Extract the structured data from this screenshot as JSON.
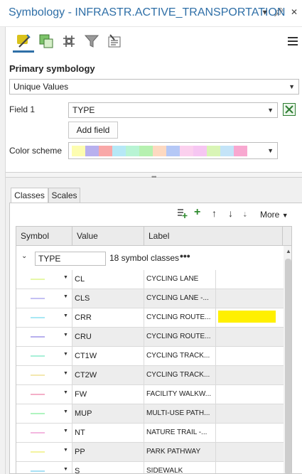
{
  "window": {
    "title": "Symbology - INFRASTR.ACTIVE_TRANSPORTATION",
    "icons": [
      "chevron-down-icon",
      "pin-icon",
      "close-icon"
    ]
  },
  "toolbar": {
    "icons": [
      "primary-symbology-icon",
      "vary-symbology-icon",
      "symbol-layers-icon",
      "filter-icon",
      "properties-icon",
      "menu-icon"
    ]
  },
  "primary": {
    "heading": "Primary symbology",
    "renderer": "Unique Values",
    "field1_label": "Field 1",
    "field1_value": "TYPE",
    "add_field": "Add field",
    "color_scheme_label": "Color scheme",
    "color_scheme_colors": [
      "#fdfdb0",
      "#b8b0ee",
      "#f9a8a8",
      "#b6e8f6",
      "#b8f4d4",
      "#b6f1b0",
      "#fdd9c1",
      "#b5c8f6",
      "#fbd0ee",
      "#f6c6f2",
      "#d9f5b6",
      "#c4e4f8",
      "#f8a8d0"
    ]
  },
  "tabs": [
    {
      "label": "Classes",
      "active": true
    },
    {
      "label": "Scales",
      "active": false
    }
  ],
  "class_tools": {
    "more_label": "More",
    "icons": [
      "add-values-icon",
      "add-icon",
      "move-up-icon",
      "move-down-icon",
      "more-chevron-down-icon"
    ]
  },
  "grid": {
    "columns": [
      "Symbol",
      "Value",
      "Label"
    ],
    "group": {
      "field": "TYPE",
      "count_text": "18 symbol classes",
      "menu": "•••"
    },
    "rows": [
      {
        "value": "CL",
        "label": "CYCLING LANE",
        "color": "#e6f7a8",
        "highlight": false
      },
      {
        "value": "CLS",
        "label": "CYCLING LANE -...",
        "color": "#c4c0f4",
        "highlight": false
      },
      {
        "value": "CRR",
        "label": "CYCLING ROUTE...",
        "color": "#a8e8f4",
        "highlight": true
      },
      {
        "value": "CRU",
        "label": "CYCLING ROUTE...",
        "color": "#b8b0ee",
        "highlight": false
      },
      {
        "value": "CT1W",
        "label": "CYCLING TRACK...",
        "color": "#a8f0d8",
        "highlight": false
      },
      {
        "value": "CT2W",
        "label": "CYCLING TRACK...",
        "color": "#f4e8b0",
        "highlight": false
      },
      {
        "value": "FW",
        "label": "FACILITY WALKW...",
        "color": "#f4b0c8",
        "highlight": false
      },
      {
        "value": "MUP",
        "label": "MULTI-USE PATH...",
        "color": "#b0f4c0",
        "highlight": false
      },
      {
        "value": "NT",
        "label": "NATURE TRAIL -...",
        "color": "#f4b8e0",
        "highlight": false
      },
      {
        "value": "PP",
        "label": "PARK PATHWAY",
        "color": "#f4f4a0",
        "highlight": false
      },
      {
        "value": "S",
        "label": "SIDEWALK",
        "color": "#a8e0f4",
        "highlight": false
      }
    ]
  }
}
